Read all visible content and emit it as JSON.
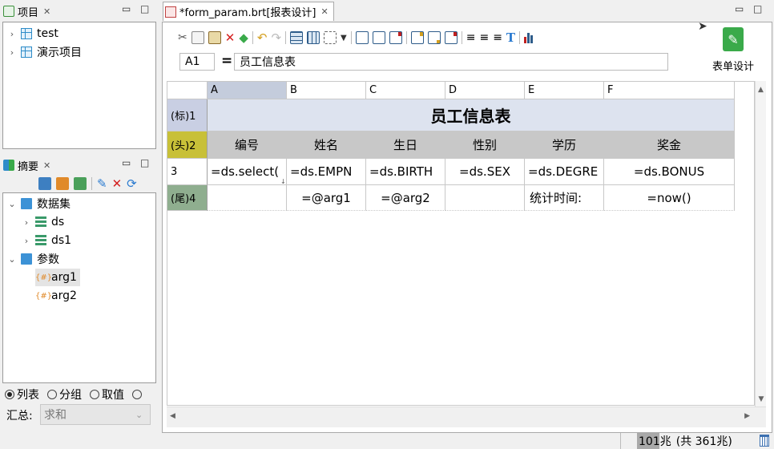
{
  "project_panel": {
    "title": "项目",
    "items": [
      {
        "label": "test"
      },
      {
        "label": "演示项目"
      }
    ]
  },
  "summary_panel": {
    "title": "摘要",
    "tree": {
      "dataset_group": "数据集",
      "datasets": [
        "ds",
        "ds1"
      ],
      "params_group": "参数",
      "params": [
        "arg1",
        "arg2"
      ]
    },
    "radio_options": [
      "列表",
      "分组",
      "取值"
    ],
    "aggregate_label": "汇总:",
    "aggregate_value": "求和"
  },
  "editor": {
    "tab_title": "*form_param.brt[报表设计]",
    "cell_ref": "A1",
    "equals": "=",
    "formula": "员工信息表",
    "form_design_label": "表单设计"
  },
  "grid": {
    "columns": [
      "A",
      "B",
      "C",
      "D",
      "E",
      "F"
    ],
    "row_headers": [
      "(标)1",
      "(头)2",
      "3",
      "(尾)4"
    ],
    "title_cell": "员工信息表",
    "header_row": [
      "编号",
      "姓名",
      "生日",
      "性别",
      "学历",
      "奖金"
    ],
    "data_row": [
      "=ds.select(",
      "=ds.EMPN",
      "=ds.BIRTH",
      "=ds.SEX",
      "=ds.DEGRE",
      "=ds.BONUS"
    ],
    "footer_row": [
      "",
      "=@arg1",
      "=@arg2",
      "",
      "统计时间:",
      "=now()"
    ]
  },
  "status_bar": {
    "memory_used": "101兆",
    "memory_total": "(共 361兆)"
  },
  "colors": {
    "title_row_bg": "#dde3ef",
    "header_row_bg": "#c8c8c8",
    "row1_header_bg": "#c9cfe3",
    "row2_header_bg": "#c8c038",
    "row4_header_bg": "#8fae8f",
    "selected_col_bg": "#c4ccdc",
    "form_icon_green": "#3aaa4a"
  }
}
